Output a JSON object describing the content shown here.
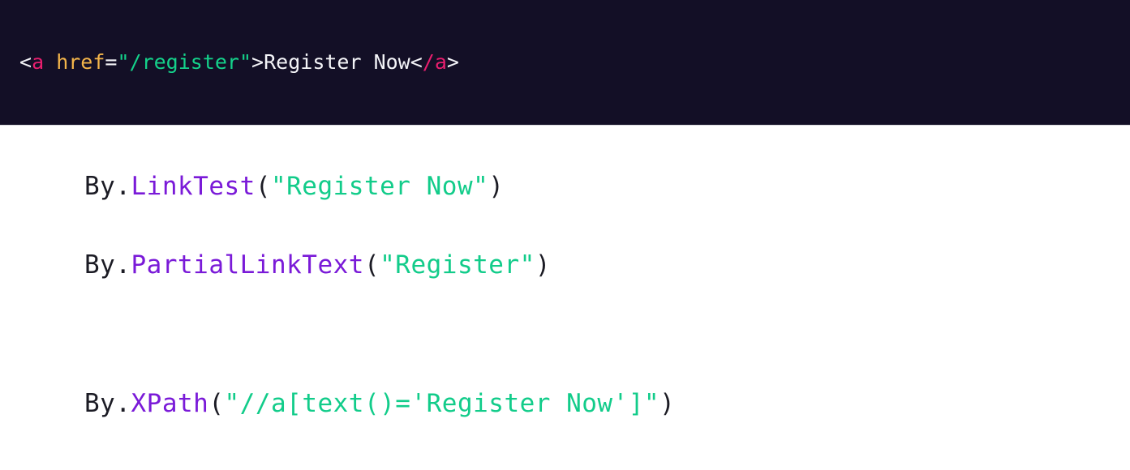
{
  "colors": {
    "header_background": "#130f26",
    "page_background": "#ffffff",
    "header_text": "#f4f4f8",
    "tag_name": "#e81e6e",
    "attribute_name": "#f4b54a",
    "attribute_value": "#14d28b",
    "code_text": "#1b1b24",
    "method_name": "#7a1ad8",
    "string_literal": "#12cc8a"
  },
  "html_snippet": {
    "open_bracket": "<",
    "tag_open": "a",
    "space": " ",
    "attribute": "href",
    "equals": "=",
    "attribute_value": "\"/register\"",
    "close_bracket": ">",
    "link_text": "Register Now",
    "close_tag_open": "<",
    "close_slash_tag": "/a",
    "close_tag_end": ">"
  },
  "locators": [
    {
      "prefix": "By",
      "dot": ".",
      "method": "LinkTest",
      "open_paren": "(",
      "argument": "\"Register Now\"",
      "close_paren": ")"
    },
    {
      "prefix": "By",
      "dot": ".",
      "method": "PartialLinkText",
      "open_paren": "(",
      "argument": "\"Register\"",
      "close_paren": ")"
    },
    {
      "prefix": "By",
      "dot": ".",
      "method": "XPath",
      "open_paren": "(",
      "argument": "\"//a[text()='Register Now']\"",
      "close_paren": ")"
    }
  ]
}
